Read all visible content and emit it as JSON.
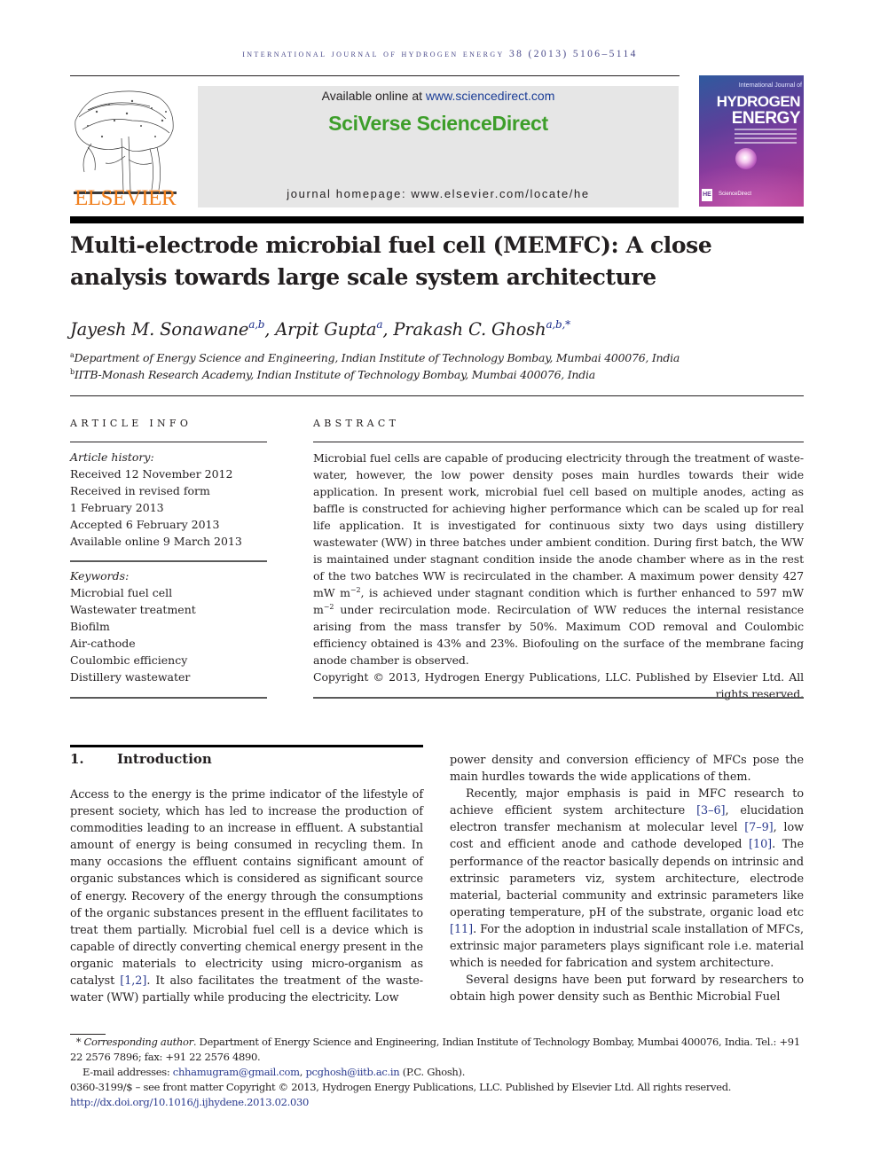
{
  "header": {
    "running_head": "International Journal of Hydrogen Energy 38 (2013) 5106–5114",
    "publisher_logo_text": "ELSEVIER",
    "available_online_prefix": "Available online at ",
    "available_online_link": "www.sciencedirect.com",
    "platform_brand": "SciVerse ScienceDirect",
    "journal_homepage": "journal homepage: www.elsevier.com/locate/he",
    "cover": {
      "subtitle": "International Journal of",
      "title_line1": "HYDROGEN",
      "title_line2": "ENERGY",
      "badge": "HE",
      "footer": "ScienceDirect"
    }
  },
  "article": {
    "title": "Multi-electrode microbial fuel cell (MEMFC): A close analysis towards large scale system architecture",
    "authors": [
      {
        "name": "Jayesh M. Sonawane",
        "affil": "a,b",
        "sep": ", "
      },
      {
        "name": "Arpit Gupta",
        "affil": "a",
        "sep": ", "
      },
      {
        "name": "Prakash C. Ghosh",
        "affil": "a,b,*",
        "sep": ""
      }
    ],
    "affiliations": [
      {
        "mark": "a",
        "text": "Department of Energy Science and Engineering, Indian Institute of Technology Bombay, Mumbai 400076, India"
      },
      {
        "mark": "b",
        "text": "IITB-Monash Research Academy, Indian Institute of Technology Bombay, Mumbai 400076, India"
      }
    ]
  },
  "article_info": {
    "heading": "ARTICLE INFO",
    "history_label": "Article history:",
    "history": [
      "Received 12 November 2012",
      "Received in revised form",
      "1 February 2013",
      "Accepted 6 February 2013",
      "Available online 9 March 2013"
    ],
    "keywords_label": "Keywords:",
    "keywords": [
      "Microbial fuel cell",
      "Wastewater treatment",
      "Biofilm",
      "Air-cathode",
      "Coulombic efficiency",
      "Distillery wastewater"
    ]
  },
  "abstract": {
    "heading": "ABSTRACT",
    "part1": "Microbial fuel cells are capable of producing electricity through the treatment of waste-water, however, the low power density poses main hurdles towards their wide application. In present work, microbial fuel cell based on multiple anodes, acting as baffle is constructed for achieving higher performance which can be scaled up for real life application. It is investigated for continuous sixty two days using distillery wastewater (WW) in three batches under ambient condition. During first batch, the WW is maintained under stagnant condition inside the anode chamber where as in the rest of the two batches WW is recirculated in the chamber. A maximum power density 427 mW m",
    "sup1": "−2",
    "part2": ", is achieved under stagnant condition which is further enhanced to 597 mW m",
    "sup2": "−2",
    "part3": " under recirculation mode. Recirculation of WW reduces the internal resistance arising from the mass transfer by 50%. Maximum COD removal and Coulombic efficiency obtained is 43% and 23%. Biofouling on the surface of the membrane facing anode chamber is observed.",
    "copyright": "Copyright © 2013, Hydrogen Energy Publications, LLC. Published by Elsevier Ltd. All rights reserved."
  },
  "introduction": {
    "number": "1.",
    "title": "Introduction",
    "left_p1_a": "Access to the energy is the prime indicator of the lifestyle of present society, which has led to increase the production of commodities leading to an increase in effluent. A substantial amount of energy is being consumed in recycling them. In many occasions the effluent contains significant amount of organic substances which is considered as significant source of energy. Recovery of the energy through the consumptions of the organic substances present in the effluent facilitates to treat them partially. Microbial fuel cell is a device which is capable of directly converting chemical energy present in the organic materials to electricity using micro-organism as catalyst ",
    "left_ref1": "[1,2]",
    "left_p1_b": ". It also facilitates the treatment of the waste-water (WW) partially while producing the electricity. Low",
    "right_p1": "power density and conversion efficiency of MFCs pose the main hurdles towards the wide applications of them.",
    "right_p2_a": "Recently, major emphasis is paid in MFC research to achieve efficient system architecture ",
    "right_ref1": "[3–6]",
    "right_p2_b": ", elucidation electron transfer mechanism at molecular level ",
    "right_ref2": "[7–9]",
    "right_p2_c": ", low cost and efficient anode and cathode developed ",
    "right_ref3": "[10]",
    "right_p2_d": ". The performance of the reactor basically depends on intrinsic and extrinsic parameters viz, system architecture, electrode material, bacterial community and extrinsic parameters like operating temperature, pH of the substrate, organic load etc ",
    "right_ref4": "[11]",
    "right_p2_e": ". For the adoption in industrial scale installation of MFCs, extrinsic major parameters plays significant role i.e. material which is needed for fabrication and system architecture.",
    "right_p3": "Several designs have been put forward by researchers to obtain high power density such as Benthic Microbial Fuel"
  },
  "footnotes": {
    "star": "*",
    "corr_label": "Corresponding author",
    "corr_text": ". Department of Energy Science and Engineering, Indian Institute of Technology Bombay, Mumbai 400076, India. Tel.: +91 22 2576 7896; fax: +91 22 2576 4890.",
    "email_label": "E-mail addresses: ",
    "email1": "chhamugram@gmail.com",
    "email_sep": ", ",
    "email2": "pcghosh@iitb.ac.in",
    "email_owner": " (P.C. Ghosh).",
    "issn_line": "0360-3199/$ – see front matter Copyright © 2013, Hydrogen Energy Publications, LLC. Published by Elsevier Ltd. All rights reserved.",
    "doi": "http://dx.doi.org/10.1016/j.ijhydene.2013.02.030"
  },
  "colors": {
    "elsevier_orange": "#f07f1d",
    "sciencedirect_green": "#3d9e2a",
    "link_blue": "#2a3a8f",
    "running_head": "#4a4a8a"
  }
}
